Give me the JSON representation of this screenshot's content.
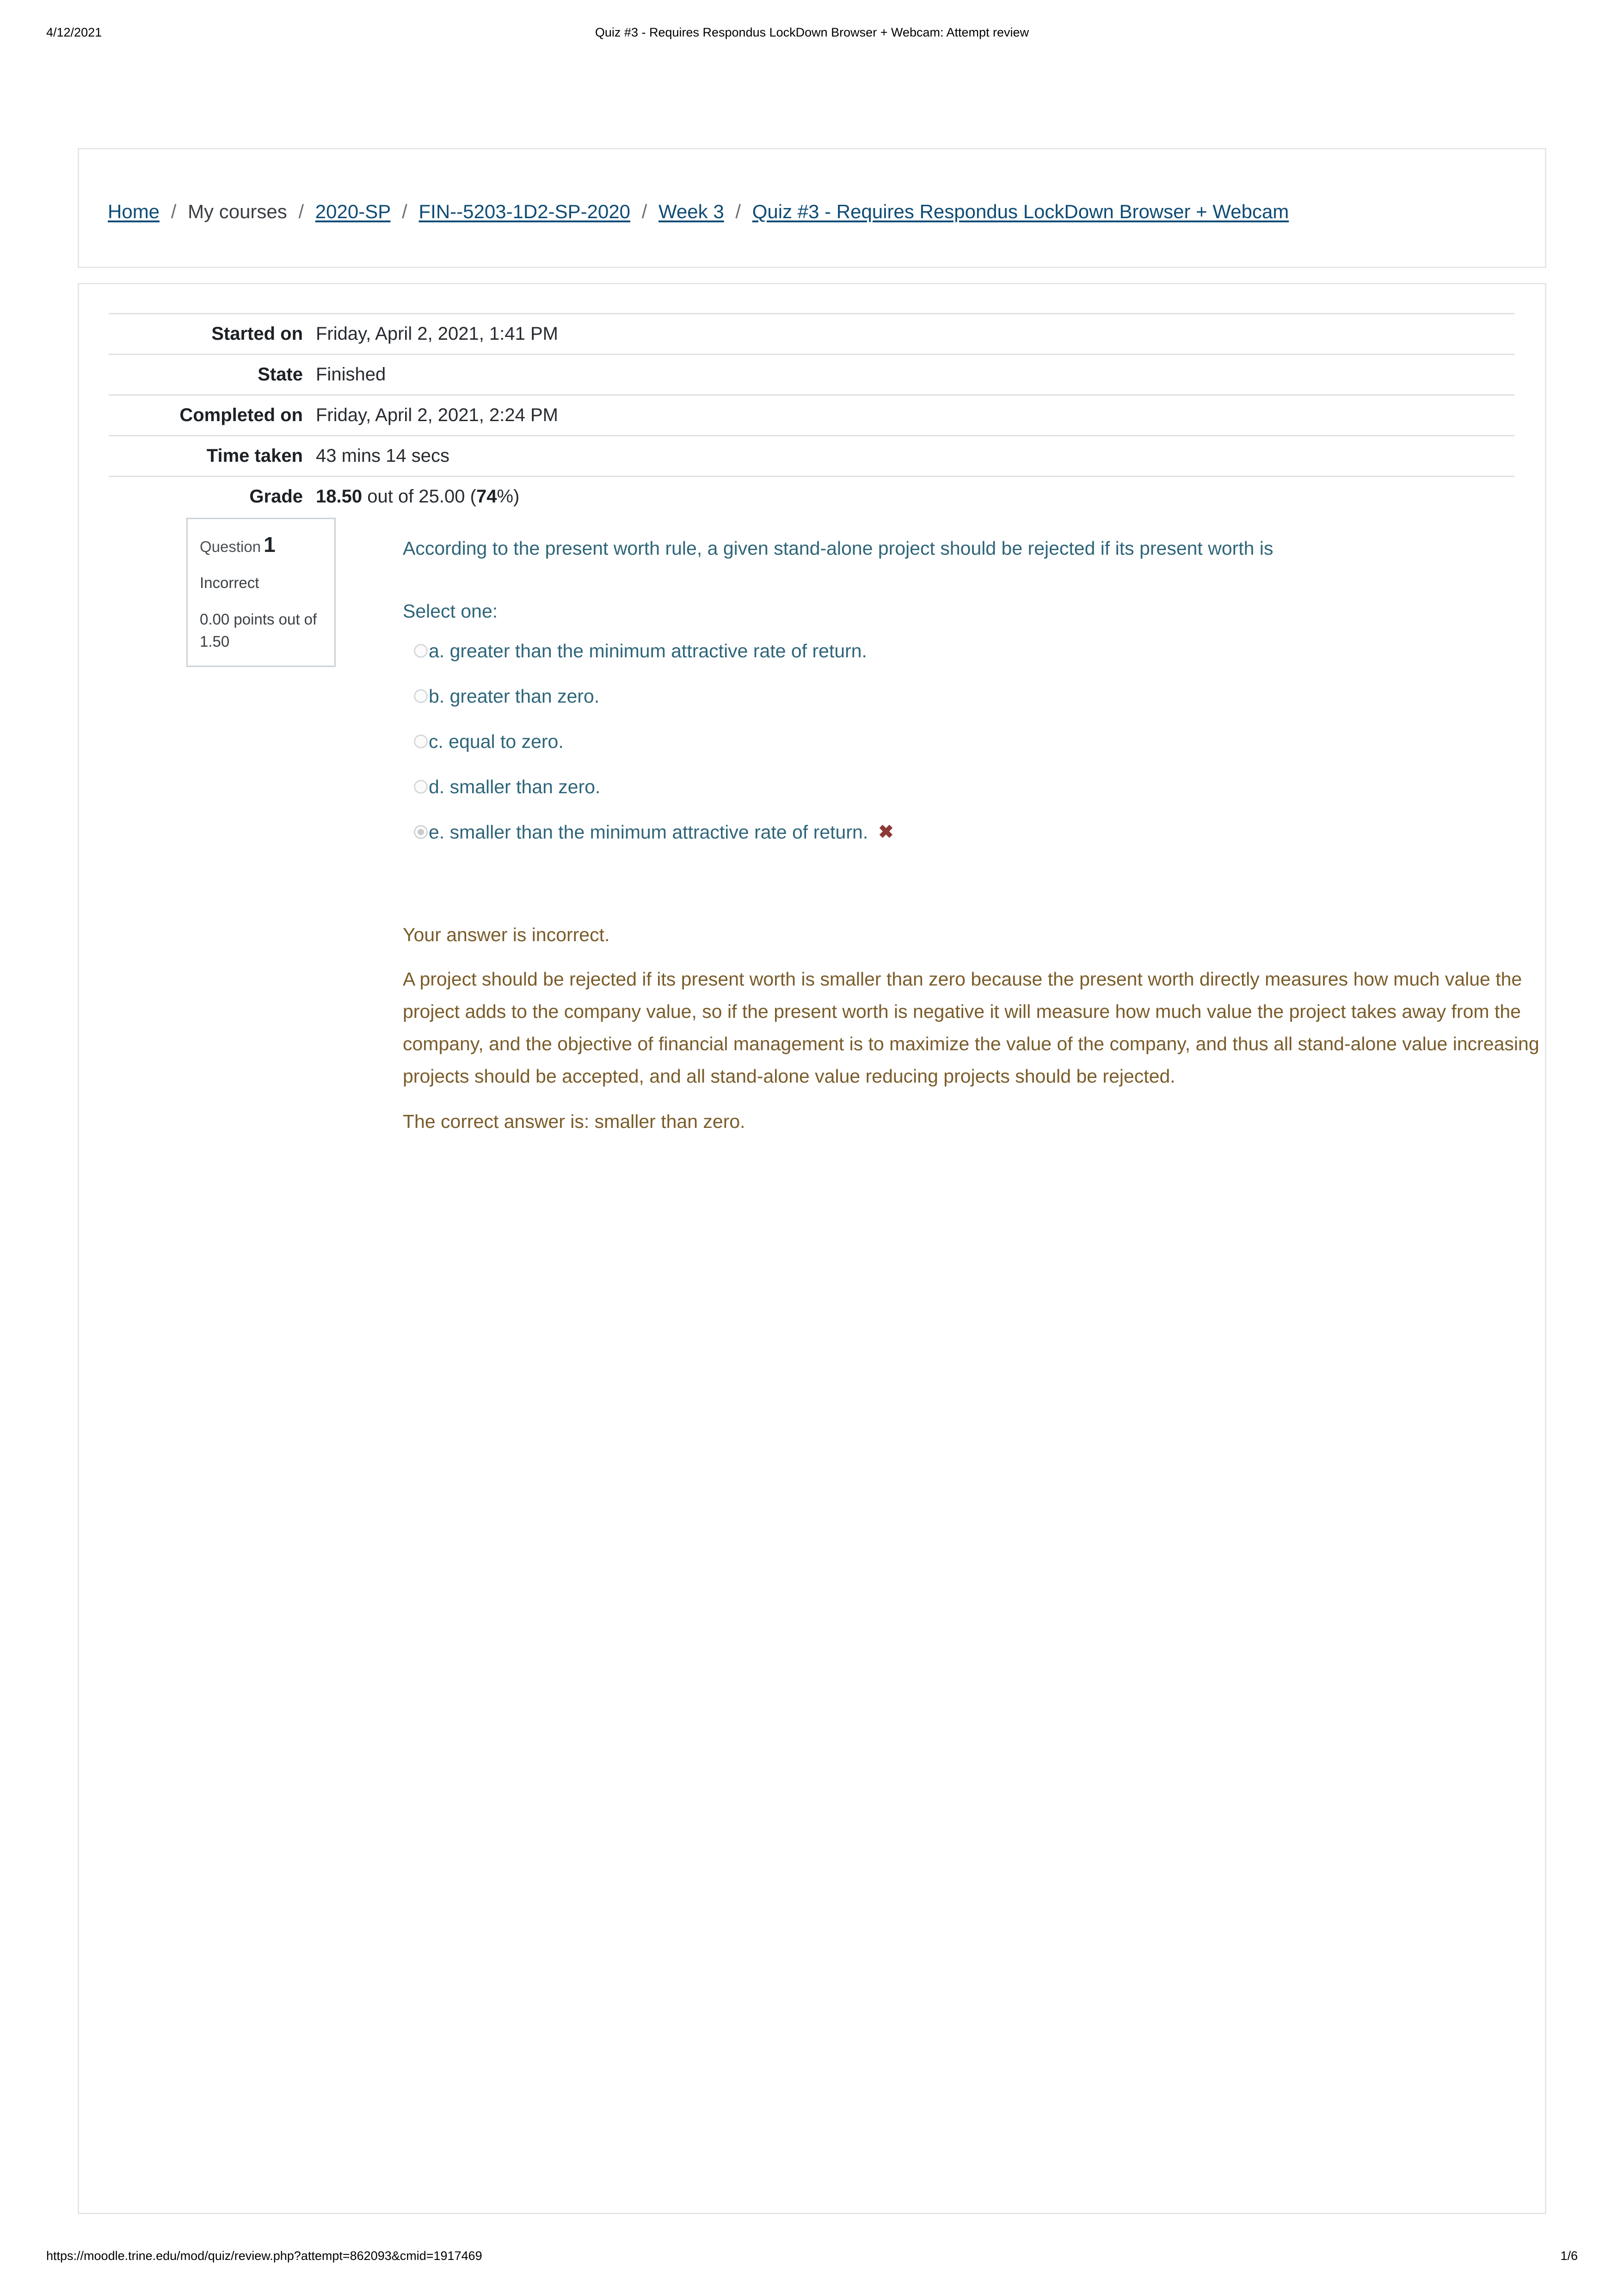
{
  "print": {
    "date": "4/12/2021",
    "title": "Quiz #3 - Requires Respondus LockDown Browser + Webcam: Attempt review",
    "url": "https://moodle.trine.edu/mod/quiz/review.php?attempt=862093&cmid=1917469",
    "page": "1/6"
  },
  "breadcrumb": {
    "items": [
      {
        "label": "Home",
        "link": true
      },
      {
        "label": "My courses",
        "link": false
      },
      {
        "label": "2020-SP",
        "link": true
      },
      {
        "label": "FIN--5203-1D2-SP-2020",
        "link": true
      },
      {
        "label": "Week 3",
        "link": true
      },
      {
        "label": "Quiz #3 - Requires Respondus LockDown Browser + Webcam",
        "link": true
      }
    ],
    "separator": "/"
  },
  "summary": {
    "rows": [
      {
        "label": "Started on",
        "value": "Friday, April 2, 2021, 1:41 PM"
      },
      {
        "label": "State",
        "value": "Finished"
      },
      {
        "label": "Completed on",
        "value": "Friday, April 2, 2021, 2:24 PM"
      },
      {
        "label": "Time taken",
        "value": "43 mins 14 secs"
      }
    ],
    "grade": {
      "label": "Grade",
      "score": "18.50",
      "mid": " out of 25.00 (",
      "percent": "74",
      "end": "%)"
    }
  },
  "question": {
    "info": {
      "question_word": "Question",
      "number": "1",
      "state": "Incorrect",
      "grade": "0.00 points out of 1.50"
    },
    "text": "According to the present worth rule, a given stand-alone project should be rejected if its present worth is",
    "prompt": "Select one:",
    "options": [
      {
        "label": "a. greater than the minimum attractive rate of return.",
        "selected": false,
        "mark": ""
      },
      {
        "label": "b. greater than zero.",
        "selected": false,
        "mark": ""
      },
      {
        "label": "c. equal to zero.",
        "selected": false,
        "mark": ""
      },
      {
        "label": "d. smaller than zero.",
        "selected": false,
        "mark": ""
      },
      {
        "label": "e. smaller than the minimum attractive rate of return.",
        "selected": true,
        "mark": "✖"
      }
    ],
    "feedback": {
      "verdict": "Your answer is incorrect.",
      "explanation": "A project should be rejected if its present worth is smaller than zero because the present worth directly measures how much value the project adds to the company value, so if the present worth is negative it will measure how much value the project takes away from the company, and the objective of financial management is to maximize the value of the company, and thus all stand-alone value increasing projects should be accepted, and all stand-alone value reducing projects should be rejected.",
      "correct_answer": "The correct answer is: smaller than zero."
    }
  },
  "colors": {
    "link": "#0f4c75",
    "question_text": "#2e6579",
    "feedback_text": "#7a5c2a",
    "incorrect_mark": "#8b3a36",
    "card_border": "#e4e6e8"
  }
}
